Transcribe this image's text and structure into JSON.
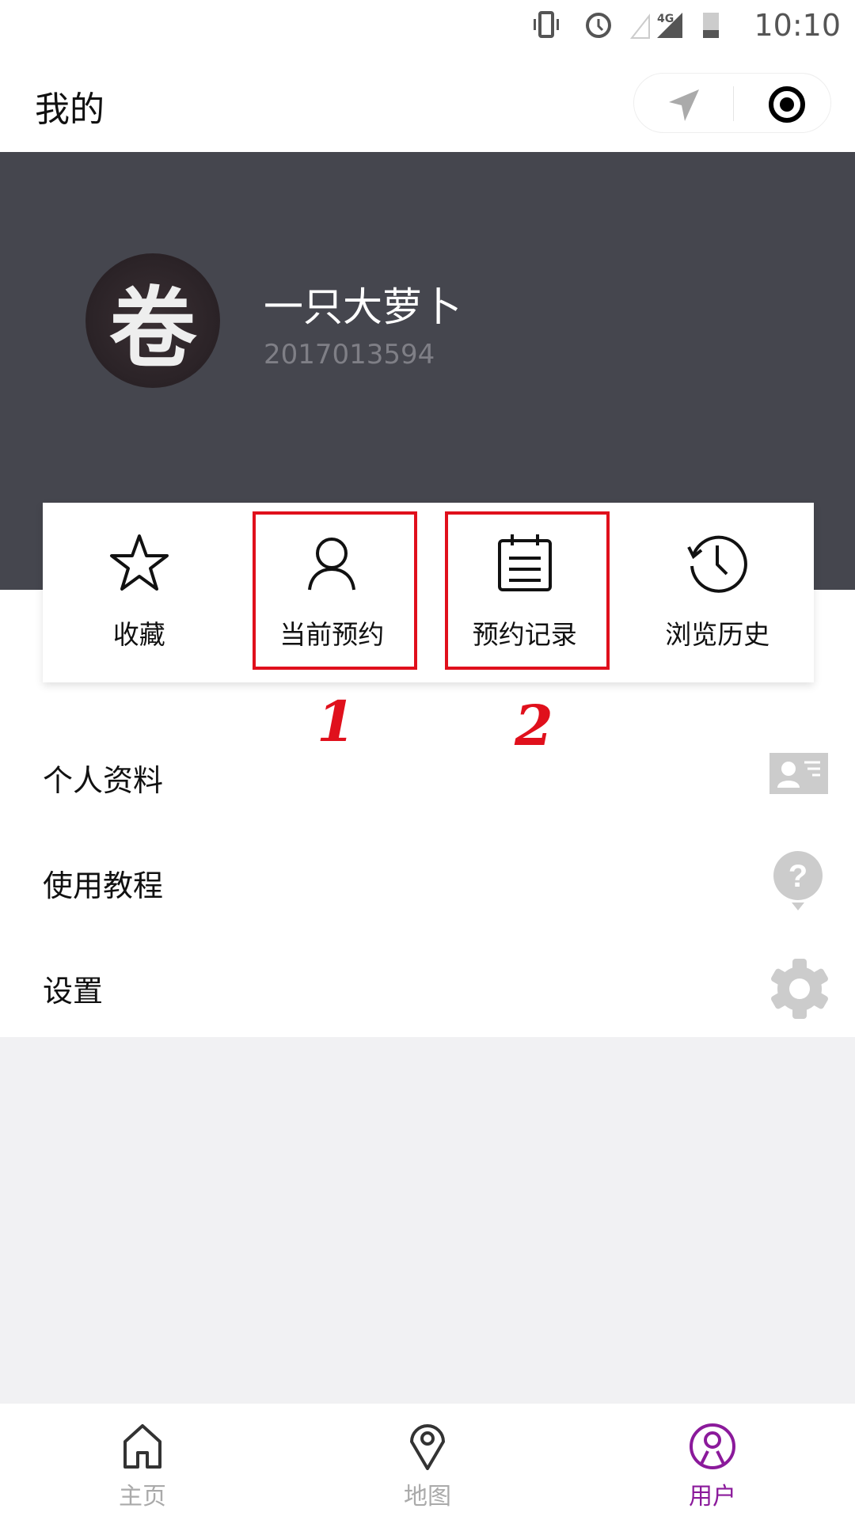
{
  "status_bar": {
    "time": "10:10",
    "network": "4G"
  },
  "header": {
    "title": "我的"
  },
  "profile": {
    "name": "一只大萝卜",
    "user_id": "2017013594",
    "avatar_char": "卷"
  },
  "quick_actions": [
    {
      "label": "收藏",
      "icon": "star-icon"
    },
    {
      "label": "当前预约",
      "icon": "person-icon"
    },
    {
      "label": "预约记录",
      "icon": "calendar-icon"
    },
    {
      "label": "浏览历史",
      "icon": "history-clock-icon"
    }
  ],
  "annotations": [
    "1",
    "2"
  ],
  "menu": [
    {
      "label": "个人资料",
      "icon": "id-card-icon"
    },
    {
      "label": "使用教程",
      "icon": "help-icon"
    },
    {
      "label": "设置",
      "icon": "gear-icon"
    }
  ],
  "tabs": [
    {
      "label": "主页"
    },
    {
      "label": "地图"
    },
    {
      "label": "用户",
      "active": true
    }
  ],
  "colors": {
    "accent": "#8b1a9b",
    "banner": "#45464e",
    "highlight": "#e0101c"
  }
}
